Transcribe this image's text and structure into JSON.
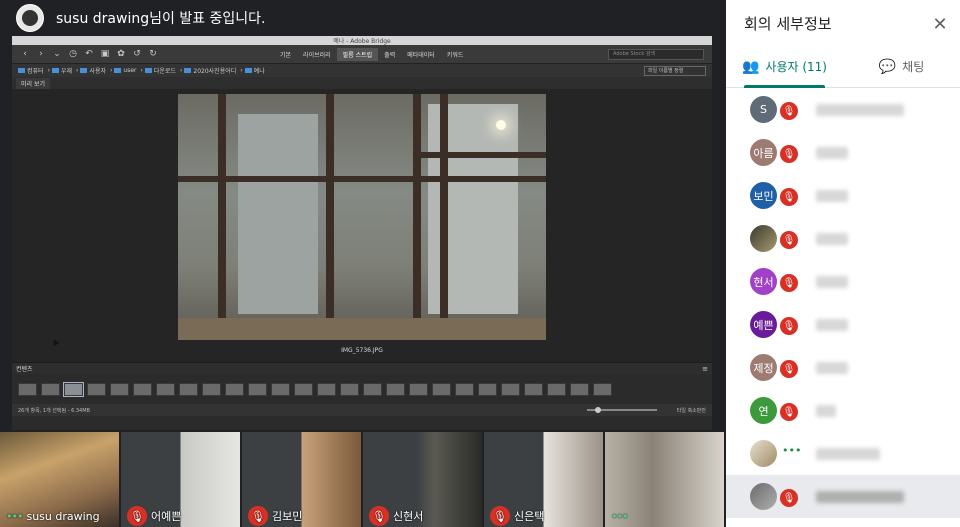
{
  "presenter": {
    "text": "susu drawing님이 발표 중입니다."
  },
  "bridge": {
    "window_title": "예나 - Adobe Bridge",
    "tabs": [
      "기본",
      "라이브러리",
      "필름 스트립",
      "출력",
      "메타데이터",
      "키워드"
    ],
    "active_tab": "필름 스트립",
    "search_placeholder": "Adobe Stock 검색",
    "breadcrumbs": [
      "컴퓨터",
      "우재",
      "사용자",
      "user",
      "다운로드",
      "2020사진용어디",
      "예나"
    ],
    "sort_label": "파일 이름별 정렬",
    "preview_tab": "미리 보기",
    "photo_name": "IMG_5736.JPG",
    "content_tab": "컨텐츠",
    "status_text": "26개 항목, 1개 선택됨 - 6.34MB",
    "view_options": "타일  축소판만"
  },
  "tiles": [
    {
      "name": "susu drawing",
      "muted": false,
      "speaking": true
    },
    {
      "name": "어예쁜",
      "muted": true
    },
    {
      "name": "김보민",
      "muted": true
    },
    {
      "name": "신현서",
      "muted": true
    },
    {
      "name": "신은택",
      "muted": true
    },
    {
      "name": "",
      "muted": false,
      "speaking": true
    }
  ],
  "panel": {
    "title": "회의 세부정보",
    "tabs": {
      "people": "사용자 (11)",
      "chat": "채팅"
    },
    "participants": [
      {
        "initials": "S",
        "color": "#5f6b77",
        "muted": true
      },
      {
        "initials": "아름",
        "color": "#9e7b72",
        "muted": true
      },
      {
        "initials": "보민",
        "color": "#1e5fa8",
        "muted": true
      },
      {
        "initials": "",
        "color": "#6b5b3e",
        "muted": true
      },
      {
        "initials": "현서",
        "color": "#a142c6",
        "muted": true
      },
      {
        "initials": "예쁜",
        "color": "#6a1b9a",
        "muted": true
      },
      {
        "initials": "제정",
        "color": "#9e7b72",
        "muted": true
      },
      {
        "initials": "연",
        "color": "#3c9a3c",
        "muted": true
      },
      {
        "initials": "",
        "color": "#d8d0c0",
        "muted": false
      },
      {
        "initials": "",
        "color": "#8a8a8a",
        "muted": true
      }
    ]
  }
}
